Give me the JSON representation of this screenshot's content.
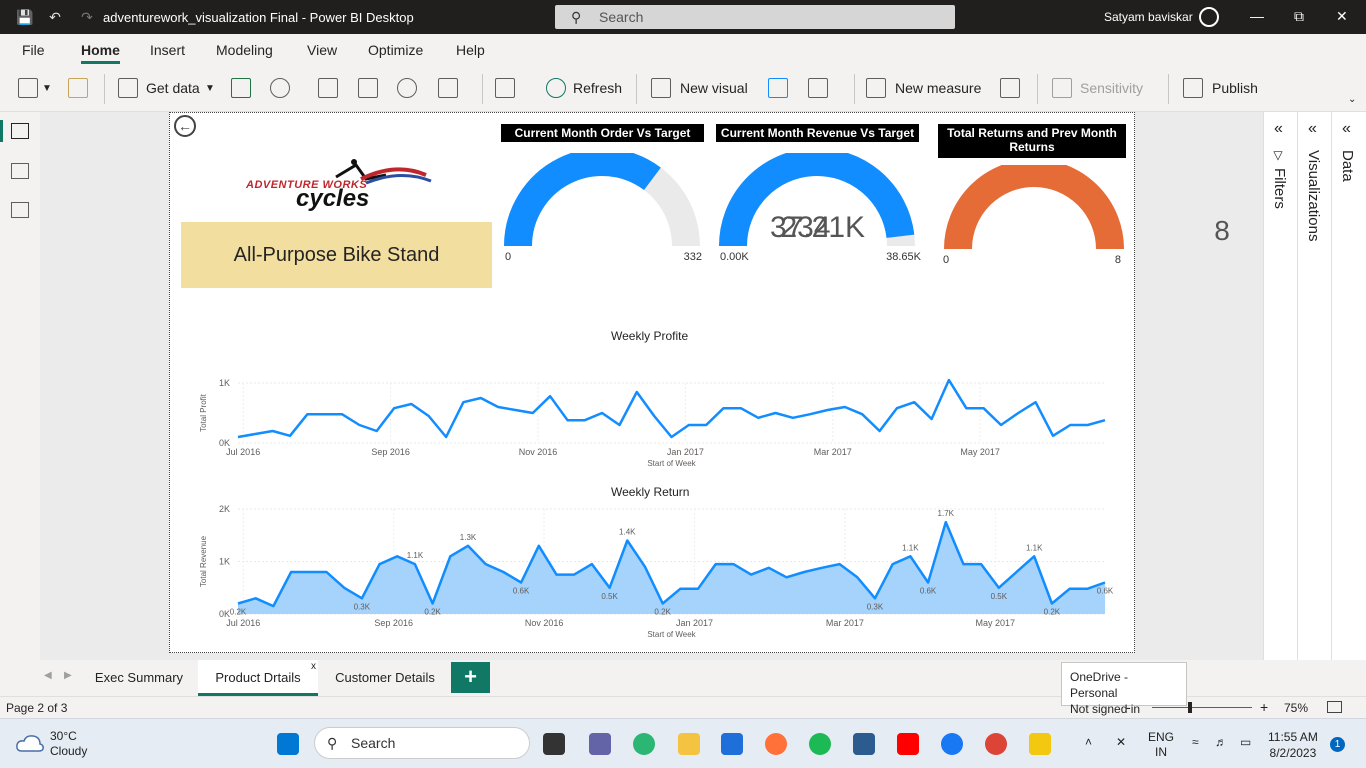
{
  "window": {
    "title": "adventurework_visualization Final - Power BI Desktop",
    "search_placeholder": "Search",
    "user_name": "Satyam baviskar"
  },
  "menu": {
    "tabs": [
      "File",
      "Home",
      "Insert",
      "Modeling",
      "View",
      "Optimize",
      "Help"
    ],
    "active": "Home"
  },
  "ribbon": {
    "get_data": "Get data",
    "refresh": "Refresh",
    "new_visual": "New visual",
    "new_measure": "New measure",
    "sensitivity": "Sensitivity",
    "publish": "Publish"
  },
  "report": {
    "logo": {
      "line1": "ADVENTURE WORKS",
      "line2": "cycles"
    },
    "product_name": "All-Purpose Bike Stand",
    "gauges": [
      {
        "title": "Current Month Order Vs Target",
        "value": "234",
        "min": "0",
        "max": "332",
        "fill_fraction": 0.705,
        "color": "#118dff"
      },
      {
        "title": "Current Month Revenue Vs Target",
        "value": "37.21K",
        "min": "0.00K",
        "max": "38.65K",
        "fill_fraction": 0.963,
        "color": "#118dff"
      },
      {
        "title": "Total Returns and Prev Month Returns",
        "value": "8",
        "min": "0",
        "max": "8",
        "fill_fraction": 1.0,
        "color": "#e66c37"
      }
    ]
  },
  "chart_data": [
    {
      "type": "line",
      "title": "Weekly Profite",
      "xlabel": "Start of Week",
      "ylabel": "Total Profit",
      "ylim": [
        0,
        1000
      ],
      "yticks": [
        "0K",
        "1K"
      ],
      "xticks": [
        "Jul 2016",
        "Sep 2016",
        "Nov 2016",
        "Jan 2017",
        "Mar 2017",
        "May 2017"
      ],
      "color": "#118dff",
      "values": [
        100,
        150,
        200,
        120,
        480,
        480,
        480,
        300,
        200,
        580,
        650,
        450,
        100,
        680,
        750,
        600,
        550,
        500,
        780,
        380,
        380,
        500,
        300,
        850,
        450,
        100,
        300,
        300,
        580,
        580,
        420,
        500,
        420,
        480,
        550,
        600,
        480,
        200,
        580,
        680,
        400,
        1050,
        580,
        580,
        300,
        500,
        680,
        120,
        300,
        300,
        380
      ]
    },
    {
      "type": "area",
      "title": "Weekly Return",
      "xlabel": "Start of Week",
      "ylabel": "Total Revenue",
      "ylim": [
        0,
        2000
      ],
      "yticks": [
        "0K",
        "1K",
        "2K"
      ],
      "xticks": [
        "Jul 2016",
        "Sep 2016",
        "Nov 2016",
        "Jan 2017",
        "Mar 2017",
        "May 2017"
      ],
      "color": "#118dff",
      "fill": "#a6d3fb",
      "values": [
        200,
        300,
        150,
        800,
        800,
        800,
        500,
        300,
        950,
        1100,
        950,
        200,
        1100,
        1300,
        950,
        800,
        600,
        1300,
        750,
        750,
        950,
        500,
        1400,
        900,
        200,
        480,
        480,
        950,
        950,
        750,
        880,
        700,
        800,
        880,
        950,
        700,
        300,
        950,
        1100,
        600,
        1750,
        950,
        950,
        500,
        800,
        1100,
        200,
        480,
        480,
        600
      ],
      "data_labels": [
        {
          "index": 0,
          "label": "0.2K"
        },
        {
          "index": 7,
          "label": "0.3K"
        },
        {
          "index": 10,
          "label": "1.1K"
        },
        {
          "index": 11,
          "label": "0.2K"
        },
        {
          "index": 13,
          "label": "1.3K"
        },
        {
          "index": 16,
          "label": "0.6K"
        },
        {
          "index": 21,
          "label": "0.5K"
        },
        {
          "index": 22,
          "label": "1.4K"
        },
        {
          "index": 24,
          "label": "0.2K"
        },
        {
          "index": 36,
          "label": "0.3K"
        },
        {
          "index": 38,
          "label": "1.1K"
        },
        {
          "index": 39,
          "label": "0.6K"
        },
        {
          "index": 40,
          "label": "1.7K"
        },
        {
          "index": 43,
          "label": "0.5K"
        },
        {
          "index": 45,
          "label": "1.1K"
        },
        {
          "index": 46,
          "label": "0.2K"
        },
        {
          "index": 49,
          "label": "0.6K"
        }
      ]
    }
  ],
  "panes": {
    "filters": "Filters",
    "visualizations": "Visualizations",
    "data": "Data"
  },
  "page_tabs": {
    "tabs": [
      "Exec Summary",
      "Product Drtails",
      "Customer Details"
    ],
    "active_index": 1,
    "close": "x",
    "add": "+"
  },
  "onedrive_tooltip": {
    "line1": "OneDrive - Personal",
    "line2": "Not signed in"
  },
  "status": {
    "page": "Page 2 of 3",
    "zoom": "75%",
    "minus": "-",
    "plus": "+"
  },
  "taskbar": {
    "weather_temp": "30°C",
    "weather_desc": "Cloudy",
    "search": "Search",
    "lang1": "ENG",
    "lang2": "IN",
    "time": "11:55 AM",
    "date": "8/2/2023",
    "notification_count": "1"
  }
}
